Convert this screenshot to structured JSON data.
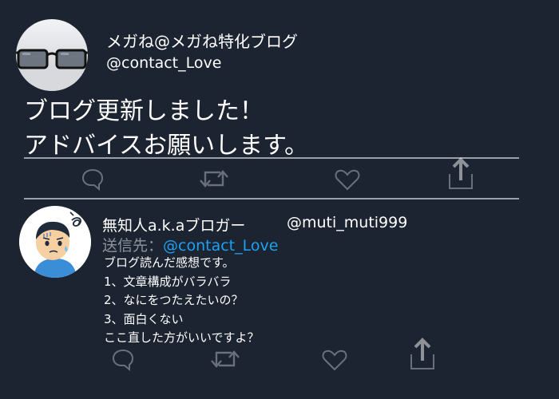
{
  "tweet": {
    "display_name": "メガね@メガね特化ブログ",
    "handle": "@contact_Love",
    "text_lines": [
      "ブログ更新しました！",
      "アドバイスお願いします。"
    ],
    "icons": [
      "reply-icon",
      "retweet-icon",
      "like-icon",
      "share-icon"
    ]
  },
  "reply": {
    "display_name": "無知人a.k.aブロガー",
    "handle": "@muti_muti999",
    "reply_to_label": "送信先：",
    "reply_to_handle": "@contact_Love",
    "text_lines": [
      "ブログ読んだ感想です。",
      "1、文章構成がバラバラ",
      "2、なにをつたえたいの？",
      "3、面白くない",
      "ここ直した方がいいですよ？"
    ],
    "icons": [
      "reply-icon",
      "retweet-icon",
      "like-icon",
      "share-icon"
    ]
  },
  "colors": {
    "background": "#1c2331",
    "link": "#1da1f2",
    "muted": "#8e949c",
    "divider": "#9aa0a8"
  }
}
